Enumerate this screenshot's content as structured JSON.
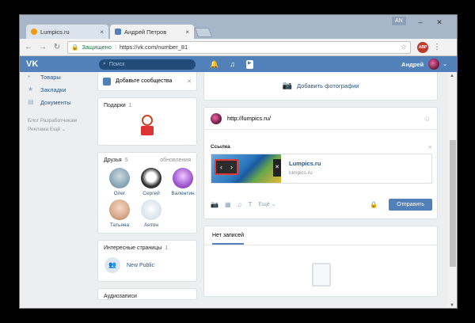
{
  "browser": {
    "tabs": [
      {
        "label": "Lumpics.ru",
        "favicon_color": "#f39c12"
      },
      {
        "label": "Андрей Петров",
        "favicon_color": "#5181b8"
      }
    ],
    "lang": "AN",
    "secure_label": "Защищено",
    "url": "https://vk.com/number_81"
  },
  "vk": {
    "logo": "VK",
    "search_placeholder": "Поиск",
    "user_name": "Андрей"
  },
  "leftnav": {
    "items": [
      {
        "label": "Товары",
        "icon": "bag-icon"
      },
      {
        "label": "Закладки",
        "icon": "star-icon"
      },
      {
        "label": "Документы",
        "icon": "document-icon"
      }
    ],
    "footer_row1": "Блог  Разработчикам",
    "footer_row2": "Реклама  Ещё ⌄"
  },
  "widgets": {
    "add_community": "Добавьте сообщества",
    "gifts_title": "Подарки",
    "gifts_count": "1",
    "friends_title": "Друзья",
    "friends_count": "5",
    "friends_updates": "обновления",
    "friends": [
      {
        "name": "Олег",
        "color": "#7fa0b3"
      },
      {
        "name": "Сергей",
        "color": "#333333"
      },
      {
        "name": "Валентин",
        "color": "#a05ad0"
      },
      {
        "name": "Татьяна",
        "color": "#d9a98a"
      },
      {
        "name": "Антон",
        "color": "#cfd8e3"
      }
    ],
    "pages_title": "Интересные страницы",
    "pages_count": "1",
    "public_name": "New Public",
    "next_title": "Аудиозаписи"
  },
  "wall": {
    "add_photos": "Добавить фотографии",
    "post_text": "http://lumpics.ru/",
    "link_label": "Ссылка",
    "link_site": "Lumpics.ru",
    "link_url": "lumpics.ru",
    "more_label": "Ещё ⌄",
    "send_label": "Отправить",
    "no_posts": "Нет записей"
  }
}
